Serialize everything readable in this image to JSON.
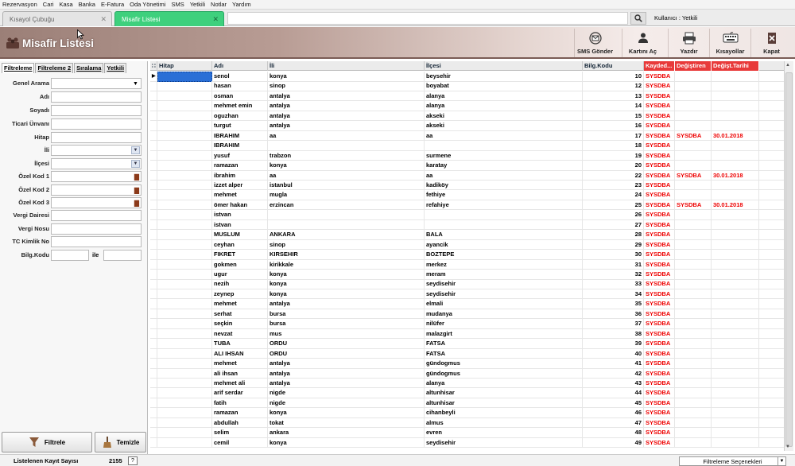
{
  "menu": [
    "Rezervasyon",
    "Cari",
    "Kasa",
    "Banka",
    "E-Fatura",
    "Oda Yönetimi",
    "SMS",
    "Yetkili",
    "Notlar",
    "Yardım"
  ],
  "tabs": [
    {
      "label": "Kısayol Çubuğu"
    },
    {
      "label": "Misafir Listesi"
    }
  ],
  "user_label": "Kullanıcı : Yetkili",
  "page_title": "Misafir Listesi",
  "toolbar": {
    "sms": "SMS Gönder",
    "card": "Kartını Aç",
    "print": "Yazdır",
    "shortcuts": "Kısayollar",
    "close": "Kapat"
  },
  "side_tabs": [
    "Filtreleme",
    "Filtreleme 2",
    "Sıralama",
    "Yetkili"
  ],
  "filters": {
    "genel_arama": "Genel Arama",
    "adi": "Adı",
    "soyadi": "Soyadı",
    "ticari": "Ticari Ünvanı",
    "hitap": "Hitap",
    "ili": "İli",
    "ilcesi": "İlçesi",
    "ozel1": "Özel Kod 1",
    "ozel2": "Özel Kod 2",
    "ozel3": "Özel Kod 3",
    "vergi_dairesi": "Vergi Dairesi",
    "vergi_nosu": "Vergi Nosu",
    "tc": "TC Kimlik No",
    "bilg": "Bilg.Kodu",
    "ile": "ile"
  },
  "buttons": {
    "filter": "Filtrele",
    "clear": "Temizle"
  },
  "columns": [
    "Hitap",
    "Adı",
    "İli",
    "İlçesi",
    "Bilg.Kodu",
    "Kayded...",
    "Değiştiren",
    "Değişt.Tarihi"
  ],
  "rows": [
    {
      "adi": "senol",
      "il": "konya",
      "ilce": "beysehir",
      "kod": "10",
      "kay": "SYSDBA",
      "deg": "",
      "tar": ""
    },
    {
      "adi": "hasan",
      "il": "sinop",
      "ilce": "boyabat",
      "kod": "12",
      "kay": "SYSDBA",
      "deg": "",
      "tar": ""
    },
    {
      "adi": "osman",
      "il": "antalya",
      "ilce": "alanya",
      "kod": "13",
      "kay": "SYSDBA",
      "deg": "",
      "tar": ""
    },
    {
      "adi": "mehmet emin",
      "il": "antalya",
      "ilce": "alanya",
      "kod": "14",
      "kay": "SYSDBA",
      "deg": "",
      "tar": ""
    },
    {
      "adi": "oguzhan",
      "il": "antalya",
      "ilce": "akseki",
      "kod": "15",
      "kay": "SYSDBA",
      "deg": "",
      "tar": ""
    },
    {
      "adi": "turgut",
      "il": "antalya",
      "ilce": "akseki",
      "kod": "16",
      "kay": "SYSDBA",
      "deg": "",
      "tar": ""
    },
    {
      "adi": "IBRAHIM",
      "il": "aa",
      "ilce": "aa",
      "kod": "17",
      "kay": "SYSDBA",
      "deg": "SYSDBA",
      "tar": "30.01.2018"
    },
    {
      "adi": "IBRAHIM",
      "il": "",
      "ilce": "",
      "kod": "18",
      "kay": "SYSDBA",
      "deg": "",
      "tar": ""
    },
    {
      "adi": "yusuf",
      "il": "trabzon",
      "ilce": "surmene",
      "kod": "19",
      "kay": "SYSDBA",
      "deg": "",
      "tar": ""
    },
    {
      "adi": "ramazan",
      "il": "konya",
      "ilce": "karatay",
      "kod": "20",
      "kay": "SYSDBA",
      "deg": "",
      "tar": ""
    },
    {
      "adi": "ibrahim",
      "il": "aa",
      "ilce": "aa",
      "kod": "22",
      "kay": "SYSDBA",
      "deg": "SYSDBA",
      "tar": "30.01.2018"
    },
    {
      "adi": "izzet alper",
      "il": "istanbul",
      "ilce": "kadiköy",
      "kod": "23",
      "kay": "SYSDBA",
      "deg": "",
      "tar": ""
    },
    {
      "adi": "mehmet",
      "il": "mugla",
      "ilce": "fethiye",
      "kod": "24",
      "kay": "SYSDBA",
      "deg": "",
      "tar": ""
    },
    {
      "adi": "ömer hakan",
      "il": "erzincan",
      "ilce": "refahiye",
      "kod": "25",
      "kay": "SYSDBA",
      "deg": "SYSDBA",
      "tar": "30.01.2018"
    },
    {
      "adi": "istvan",
      "il": "",
      "ilce": "",
      "kod": "26",
      "kay": "SYSDBA",
      "deg": "",
      "tar": ""
    },
    {
      "adi": "istvan",
      "il": "",
      "ilce": "",
      "kod": "27",
      "kay": "SYSDBA",
      "deg": "",
      "tar": ""
    },
    {
      "adi": "MUSLUM",
      "il": "ANKARA",
      "ilce": "BALA",
      "kod": "28",
      "kay": "SYSDBA",
      "deg": "",
      "tar": ""
    },
    {
      "adi": "ceyhan",
      "il": "sinop",
      "ilce": "ayancik",
      "kod": "29",
      "kay": "SYSDBA",
      "deg": "",
      "tar": ""
    },
    {
      "adi": "FIKRET",
      "il": "KIRSEHIR",
      "ilce": "BOZTEPE",
      "kod": "30",
      "kay": "SYSDBA",
      "deg": "",
      "tar": ""
    },
    {
      "adi": "gokmen",
      "il": "kirikkale",
      "ilce": "merkez",
      "kod": "31",
      "kay": "SYSDBA",
      "deg": "",
      "tar": ""
    },
    {
      "adi": "ugur",
      "il": "konya",
      "ilce": "meram",
      "kod": "32",
      "kay": "SYSDBA",
      "deg": "",
      "tar": ""
    },
    {
      "adi": "nezih",
      "il": "konya",
      "ilce": "seydisehir",
      "kod": "33",
      "kay": "SYSDBA",
      "deg": "",
      "tar": ""
    },
    {
      "adi": "zeynep",
      "il": "konya",
      "ilce": "seydisehir",
      "kod": "34",
      "kay": "SYSDBA",
      "deg": "",
      "tar": ""
    },
    {
      "adi": "mehmet",
      "il": "antalya",
      "ilce": "elmali",
      "kod": "35",
      "kay": "SYSDBA",
      "deg": "",
      "tar": ""
    },
    {
      "adi": "serhat",
      "il": "bursa",
      "ilce": "mudanya",
      "kod": "36",
      "kay": "SYSDBA",
      "deg": "",
      "tar": ""
    },
    {
      "adi": "seçkin",
      "il": "bursa",
      "ilce": "nilüfer",
      "kod": "37",
      "kay": "SYSDBA",
      "deg": "",
      "tar": ""
    },
    {
      "adi": "nevzat",
      "il": "mus",
      "ilce": "malazgirt",
      "kod": "38",
      "kay": "SYSDBA",
      "deg": "",
      "tar": ""
    },
    {
      "adi": "TUBA",
      "il": "ORDU",
      "ilce": "FATSA",
      "kod": "39",
      "kay": "SYSDBA",
      "deg": "",
      "tar": ""
    },
    {
      "adi": "ALI IHSAN",
      "il": "ORDU",
      "ilce": "FATSA",
      "kod": "40",
      "kay": "SYSDBA",
      "deg": "",
      "tar": ""
    },
    {
      "adi": "mehmet",
      "il": "antalya",
      "ilce": "gündogmus",
      "kod": "41",
      "kay": "SYSDBA",
      "deg": "",
      "tar": ""
    },
    {
      "adi": "ali ihsan",
      "il": "antalya",
      "ilce": "gündogmus",
      "kod": "42",
      "kay": "SYSDBA",
      "deg": "",
      "tar": ""
    },
    {
      "adi": "mehmet ali",
      "il": "antalya",
      "ilce": "alanya",
      "kod": "43",
      "kay": "SYSDBA",
      "deg": "",
      "tar": ""
    },
    {
      "adi": "arif serdar",
      "il": "nigde",
      "ilce": "altunhisar",
      "kod": "44",
      "kay": "SYSDBA",
      "deg": "",
      "tar": ""
    },
    {
      "adi": "fatih",
      "il": "nigde",
      "ilce": "altunhisar",
      "kod": "45",
      "kay": "SYSDBA",
      "deg": "",
      "tar": ""
    },
    {
      "adi": "ramazan",
      "il": "konya",
      "ilce": "cihanbeyli",
      "kod": "46",
      "kay": "SYSDBA",
      "deg": "",
      "tar": ""
    },
    {
      "adi": "abdullah",
      "il": "tokat",
      "ilce": "almus",
      "kod": "47",
      "kay": "SYSDBA",
      "deg": "",
      "tar": ""
    },
    {
      "adi": "selim",
      "il": "ankara",
      "ilce": "evren",
      "kod": "48",
      "kay": "SYSDBA",
      "deg": "",
      "tar": ""
    },
    {
      "adi": "cemil",
      "il": "konya",
      "ilce": "seydisehir",
      "kod": "49",
      "kay": "SYSDBA",
      "deg": "",
      "tar": ""
    }
  ],
  "status": {
    "label": "Listelenen Kayıt Sayısı",
    "count": "2155",
    "help": "?",
    "filter_options": "Filtreleme Seçenekleri"
  },
  "colors": {
    "tab_active": "#3ed07d",
    "header_red": "#e83a3a",
    "text_red": "#e00000",
    "header_brown": "#9b7f77"
  }
}
